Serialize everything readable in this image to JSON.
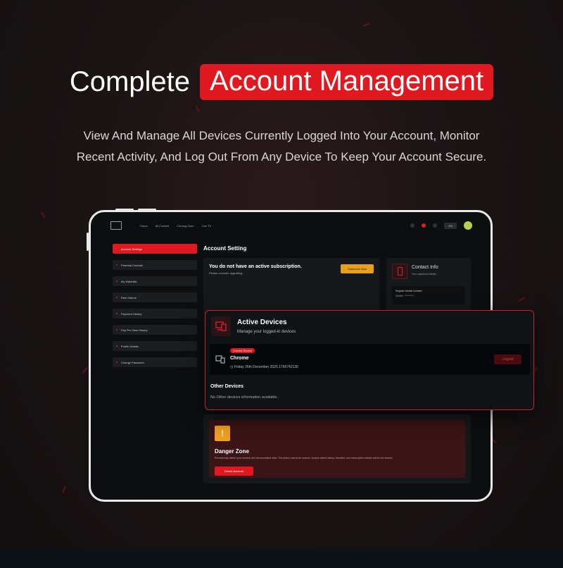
{
  "hero": {
    "title_plain": "Complete",
    "title_highlight": "Account Management",
    "subtitle_line1": "View And Manage All Devices Currently Logged Into Your Account, Monitor",
    "subtitle_line2": "Recent Activity, And Log Out From Any Device To Keep Your Account Secure."
  },
  "app": {
    "nav": [
      "Home",
      "All Content",
      "Coming Soon",
      "Live TV"
    ],
    "language": "EN",
    "sidebar": [
      "Account Settings",
      "Parental Controls",
      "My Watchlist",
      "Rent Videos",
      "Payment History",
      "Pay Per View History",
      "Profile Details",
      "Change Password"
    ],
    "page_title": "Account Setting",
    "subscription": {
      "title": "You do not have an active subscription.",
      "note": "Please consider upgrading.",
      "button": "Subscribe Now"
    },
    "contact": {
      "title": "Contact Info",
      "subtitle": "Your registered details",
      "label": "Register Mobile Number",
      "value": "Mobile: **********"
    },
    "danger": {
      "icon": "!",
      "title": "Danger Zone",
      "description": "Permanently delete your account and all associated data. This action cannot be undone. Access watch history, favorites, and subscription details will be lost forever.",
      "button": "Delete Account"
    }
  },
  "devices_popup": {
    "title": "Active Devices",
    "subtitle": "Manage your logged-in devices",
    "current_badge": "Current Device",
    "device_name": "Chrome",
    "device_date": "Friday 26th December 2025 1766742130",
    "logout": "Logout",
    "other_title": "Other Devices",
    "other_empty": "No Other devices information available."
  },
  "colors": {
    "accent": "#e01820",
    "warning": "#f0a020"
  },
  "icons": [
    "devices-icon",
    "phone-icon",
    "warning-icon",
    "clock-icon"
  ]
}
